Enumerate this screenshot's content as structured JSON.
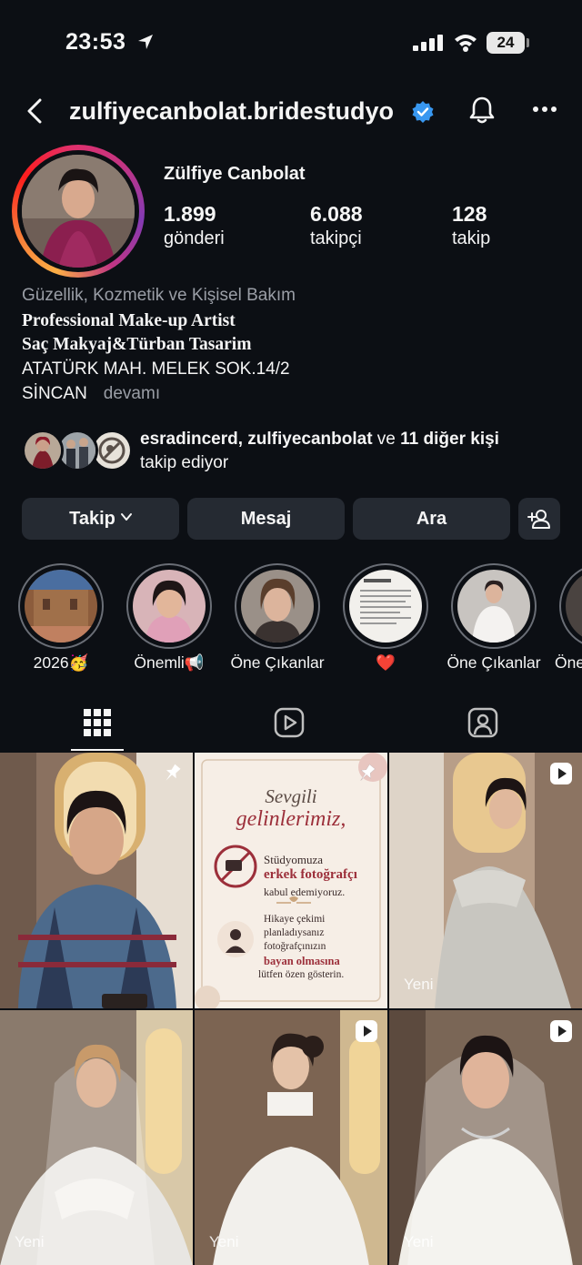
{
  "status_bar": {
    "time": "23:53",
    "battery": "24"
  },
  "header": {
    "username": "zulfiyecanbolat.bridestudyo"
  },
  "profile": {
    "display_name": "Zülfiye Canbolat",
    "stats": [
      {
        "value": "1.899",
        "label": "gönderi"
      },
      {
        "value": "6.088",
        "label": "takipçi"
      },
      {
        "value": "128",
        "label": "takip"
      }
    ]
  },
  "bio": {
    "category": "Güzellik, Kozmetik ve Kişisel Bakım",
    "line1": "Professional Make-up Artist",
    "line2": "Saç Makyaj&Türban Tasarim",
    "line3": "ATATÜRK MAH. MELEK SOK.14/2",
    "line4": "SİNCAN",
    "more": "devamı"
  },
  "followed_by": {
    "names": "esradincerd, zulfiyecanbolat",
    "connector": " ve ",
    "others": "11 diğer kişi",
    "suffix": "takip ediyor"
  },
  "actions": {
    "follow": "Takip",
    "message": "Mesaj",
    "call": "Ara"
  },
  "highlights": [
    {
      "label": "2026🥳"
    },
    {
      "label": "Önemli📢"
    },
    {
      "label": "Öne Çıkanlar"
    },
    {
      "label": "❤️"
    },
    {
      "label": "Öne Çıkanlar"
    },
    {
      "label": "Öne"
    }
  ],
  "posts": [
    {
      "badge": "pin-icon",
      "new_label": ""
    },
    {
      "badge": "pin-icon",
      "new_label": "",
      "notice": {
        "title1": "Sevgili",
        "title2": "gelinlerimiz,",
        "text1a": "Stüdyomuza",
        "text1b": "erkek fotoğrafçı",
        "text1c": "kabul edemiyoruz.",
        "text2a": "Hikaye çekimi",
        "text2b": "planladıysanız",
        "text2c": "fotoğrafçınızın",
        "text2d": "bayan olmasına",
        "text2e": "lütfen özen gösterin."
      }
    },
    {
      "badge": "reel-icon",
      "new_label": "Yeni"
    },
    {
      "badge": "",
      "new_label": "Yeni"
    },
    {
      "badge": "reel-icon",
      "new_label": "Yeni"
    },
    {
      "badge": "reel-icon",
      "new_label": "Yeni"
    }
  ],
  "colors": {
    "background": "#0c0f14",
    "button": "#252a32",
    "verified": "#3897f0",
    "accent_red": "#9c2f3a"
  }
}
